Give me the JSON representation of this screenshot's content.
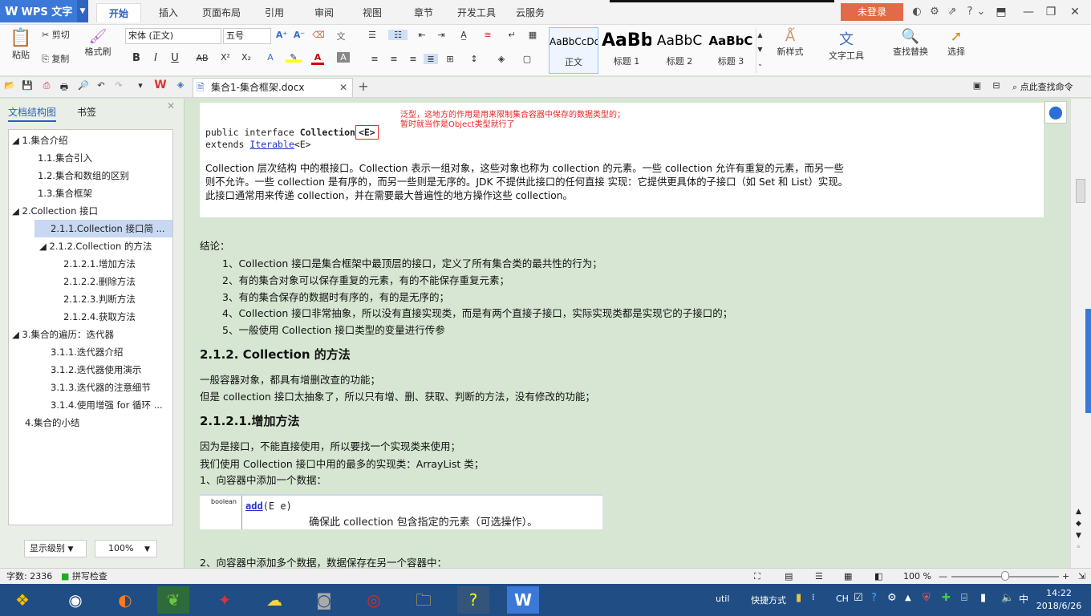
{
  "app": {
    "logo": "WPS 文字",
    "doc_tab": "集合1-集合框架.docx"
  },
  "menu_tabs": [
    "开始",
    "插入",
    "页面布局",
    "引用",
    "审阅",
    "视图",
    "章节",
    "开发工具",
    "云服务"
  ],
  "login_label": "未登录",
  "ribbon": {
    "paste": "粘贴",
    "cut": "剪切",
    "copy": "复制",
    "format_painter": "格式刷",
    "font": "宋体 (正文)",
    "size": "五号",
    "styles": [
      {
        "preview": "AaBbCcDd",
        "label": "正文"
      },
      {
        "preview": "AaBb",
        "label": "标题 1"
      },
      {
        "preview": "AaBbC",
        "label": "标题 2"
      },
      {
        "preview": "AaBbC",
        "label": "标题 3"
      }
    ],
    "new_style": "新样式",
    "text_tools": "文字工具",
    "find_replace": "查找替换",
    "select": "选择"
  },
  "search_command": "点此查找命令",
  "sidebar": {
    "tab_outline": "文档结构图",
    "tab_bookmark": "书签",
    "items": [
      "1.集合介绍",
      "1.1.集合引入",
      "1.2.集合和数组的区别",
      "1.3.集合框架",
      "2.Collection 接口",
      "2.1.1.Collection 接口简 ...",
      "2.1.2.Collection 的方法",
      "2.1.2.1.增加方法",
      "2.1.2.2.删除方法",
      "2.1.2.3.判断方法",
      "2.1.2.4.获取方法",
      "3.集合的遍历：迭代器",
      "3.1.1.迭代器介绍",
      "3.1.2.迭代器使用演示",
      "3.1.3.迭代器的注意细节",
      "3.1.4.使用增强 for 循环 ...",
      "4.集合的小结"
    ],
    "level_btn": "显示级别",
    "zoom": "100%"
  },
  "doc": {
    "code1a": "public interface ",
    "code1b": "Collection",
    "code1c": "<E>",
    "code2a": "extends ",
    "code2b": "Iterable",
    "code2c": "<E>",
    "anno1": "泛型，这地方的作用是用来限制集合容器中保存的数据类型的；",
    "anno2": "暂时就当作是Object类型就行了",
    "para1": "Collection 层次结构 中的根接口。Collection 表示一组对象，这些对象也称为 collection 的元素。一些 collection 允许有重复的元素，而另一些",
    "para2": "则不允许。一些 collection 是有序的，而另一些则是无序的。JDK 不提供此接口的任何直接 实现：它提供更具体的子接口（如 Set 和 List）实现。",
    "para3": "此接口通常用来传递 collection，并在需要最大普遍性的地方操作这些 collection。",
    "concl": "结论：",
    "c1": "1、Collection 接口是集合框架中最顶层的接口，定义了所有集合类的最共性的行为；",
    "c2": "2、有的集合对象可以保存重复的元素，有的不能保存重复元素；",
    "c3": "3、有的集合保存的数据时有序的，有的是无序的；",
    "c4": "4、Collection 接口非常抽象，所以没有直接实现类，而是有两个直接子接口，实际实现类都是实现它的子接口的；",
    "c5": "5、一般使用 Collection 接口类型的变量进行传参",
    "h1": "2.1.2. Collection 的方法",
    "p1": "一般容器对象，都具有增删改查的功能；",
    "p2": "但是 collection 接口太抽象了，所以只有增、删、获取、判断的方法，没有修改的功能；",
    "h2": "2.1.2.1.增加方法",
    "p3": "因为是接口，不能直接使用，所以要找一个实现类来使用；",
    "p4": "我们使用 Collection 接口中用的最多的实现类：ArrayList 类；",
    "p5": "1、向容器中添加一个数据：",
    "tbl_type": "boolean",
    "tbl_method": "add",
    "tbl_param": "(E e)",
    "tbl_desc": "确保此 collection 包含指定的元素（可选操作）。",
    "p6": "2、向容器中添加多个数据，数据保存在另一个容器中："
  },
  "status": {
    "wordcount": "字数: 2336",
    "spell": "拼写检查",
    "zoom": "100 %"
  },
  "tray": {
    "util": "util",
    "shortcut": "快捷方式",
    "lang": "CH",
    "time": "14:22",
    "date": "2018/6/26"
  },
  "colors": {
    "accent": "#3c78d8",
    "login": "#e06a49",
    "taskbar": "#1f4d84",
    "doc_bg": "#d6e6d2"
  }
}
